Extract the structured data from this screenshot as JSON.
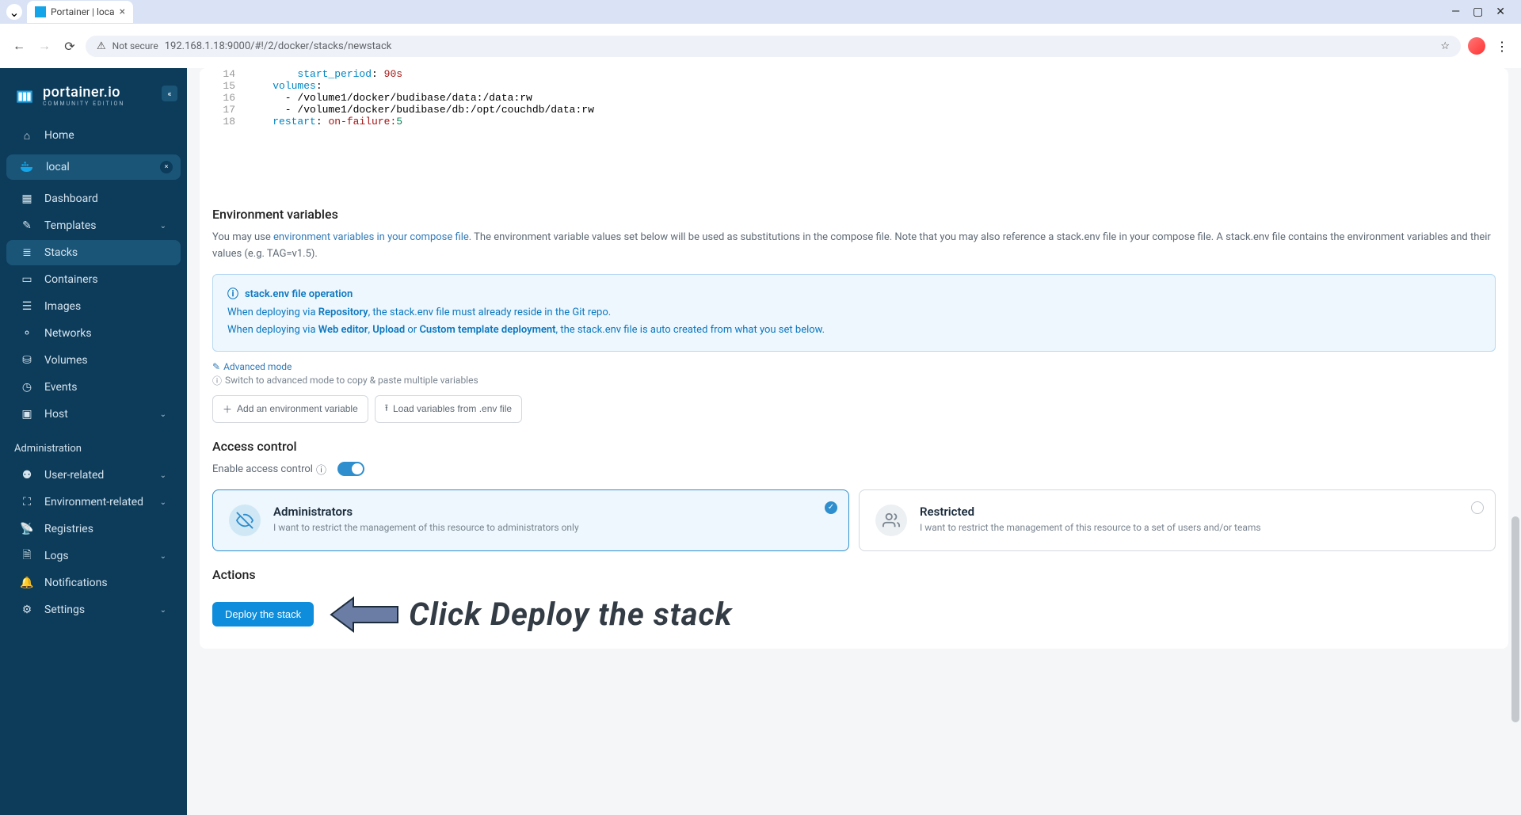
{
  "browser": {
    "tab_title": "Portainer | loca",
    "not_secure": "Not secure",
    "url": "192.168.1.18:9000/#!/2/docker/stacks/newstack"
  },
  "sidebar": {
    "logo": "portainer.io",
    "logo_sub": "COMMUNITY EDITION",
    "home": "Home",
    "env_name": "local",
    "items": [
      {
        "label": "Dashboard"
      },
      {
        "label": "Templates",
        "chevron": true
      },
      {
        "label": "Stacks",
        "active": true
      },
      {
        "label": "Containers"
      },
      {
        "label": "Images"
      },
      {
        "label": "Networks"
      },
      {
        "label": "Volumes"
      },
      {
        "label": "Events"
      },
      {
        "label": "Host",
        "chevron": true
      }
    ],
    "admin_label": "Administration",
    "admin_items": [
      {
        "label": "User-related",
        "chevron": true
      },
      {
        "label": "Environment-related",
        "chevron": true
      },
      {
        "label": "Registries"
      },
      {
        "label": "Logs",
        "chevron": true
      },
      {
        "label": "Notifications"
      },
      {
        "label": "Settings",
        "chevron": true
      }
    ]
  },
  "editor": {
    "lines": [
      {
        "n": 14,
        "indent": "        ",
        "key": "start_period",
        "val": "90s"
      },
      {
        "n": 15,
        "indent": "    ",
        "key": "volumes",
        "val": ""
      },
      {
        "n": 16,
        "indent": "      ",
        "raw": "- /volume1/docker/budibase/data:/data:rw"
      },
      {
        "n": 17,
        "indent": "      ",
        "raw": "- /volume1/docker/budibase/db:/opt/couchdb/data:rw"
      },
      {
        "n": 18,
        "indent": "    ",
        "key": "restart",
        "val": "on-failure:",
        "num": "5"
      }
    ]
  },
  "env": {
    "title": "Environment variables",
    "desc_pre": "You may use ",
    "desc_link": "environment variables in your compose file",
    "desc_post": ". The environment variable values set below will be used as substitutions in the compose file. Note that you may also reference a stack.env file in your compose file. A stack.env file contains the environment variables and their values (e.g. TAG=v1.5).",
    "info_title": "stack.env file operation",
    "info_l1a": "When deploying via ",
    "info_l1b": "Repository",
    "info_l1c": ", the stack.env file must already reside in the Git repo.",
    "info_l2a": "When deploying via ",
    "info_l2b": "Web editor",
    "info_l2c": ", ",
    "info_l2d": "Upload",
    "info_l2e": " or ",
    "info_l2f": "Custom template deployment",
    "info_l2g": ", the stack.env file is auto created from what you set below.",
    "adv_link": "Advanced mode",
    "adv_desc": "Switch to advanced mode to copy & paste multiple variables",
    "btn_add": "Add an environment variable",
    "btn_load": "Load variables from .env file"
  },
  "access": {
    "title": "Access control",
    "enable_label": "Enable access control",
    "card1_title": "Administrators",
    "card1_desc": "I want to restrict the management of this resource to administrators only",
    "card2_title": "Restricted",
    "card2_desc": "I want to restrict the management of this resource to a set of users and/or teams"
  },
  "actions": {
    "title": "Actions",
    "deploy_btn": "Deploy the stack",
    "annotation": "Click Deploy the stack"
  }
}
